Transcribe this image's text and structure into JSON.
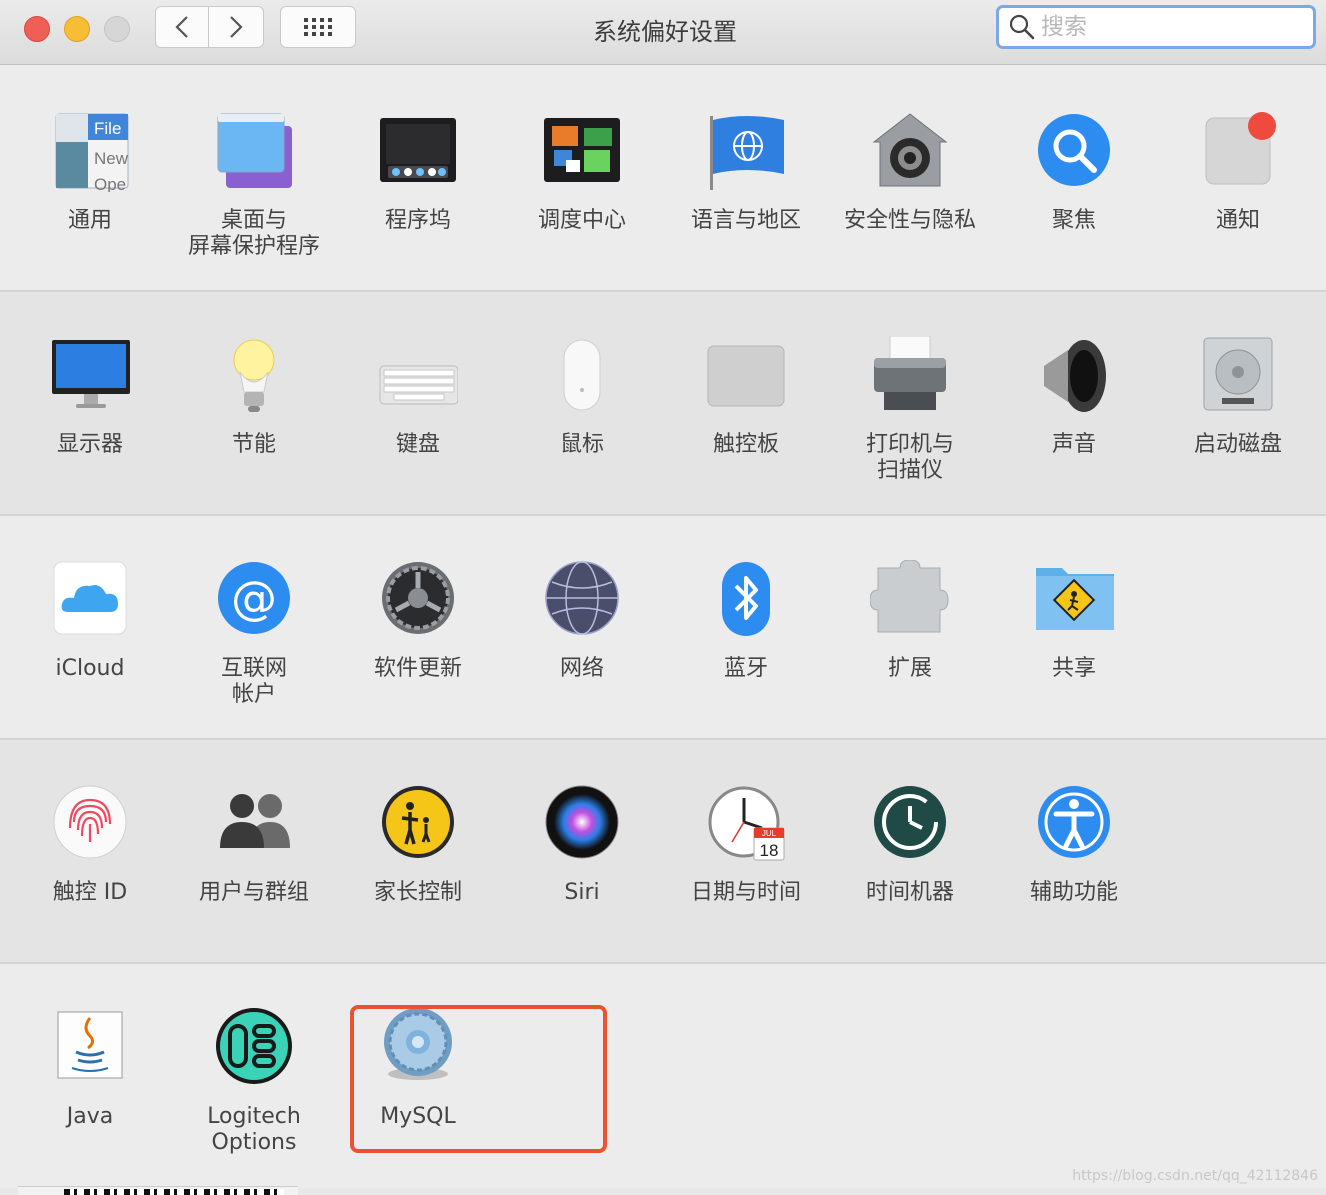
{
  "window": {
    "title": "系统偏好设置",
    "search": {
      "placeholder": "搜索",
      "value": ""
    },
    "focus_color": "#7aa8e8"
  },
  "sections": [
    {
      "panes": [
        {
          "label": "通用",
          "icon": "general-icon"
        },
        {
          "label": "桌面与\n屏幕保护程序",
          "icon": "desktop-screensaver-icon"
        },
        {
          "label": "程序坞",
          "icon": "dock-icon"
        },
        {
          "label": "调度中心",
          "icon": "mission-control-icon"
        },
        {
          "label": "语言与地区",
          "icon": "language-region-icon"
        },
        {
          "label": "安全性与隐私",
          "icon": "security-privacy-icon"
        },
        {
          "label": "聚焦",
          "icon": "spotlight-icon"
        },
        {
          "label": "通知",
          "icon": "notifications-icon"
        }
      ]
    },
    {
      "panes": [
        {
          "label": "显示器",
          "icon": "displays-icon"
        },
        {
          "label": "节能",
          "icon": "energy-saver-icon"
        },
        {
          "label": "键盘",
          "icon": "keyboard-icon"
        },
        {
          "label": "鼠标",
          "icon": "mouse-icon"
        },
        {
          "label": "触控板",
          "icon": "trackpad-icon"
        },
        {
          "label": "打印机与\n扫描仪",
          "icon": "printers-scanners-icon"
        },
        {
          "label": "声音",
          "icon": "sound-icon"
        },
        {
          "label": "启动磁盘",
          "icon": "startup-disk-icon"
        }
      ]
    },
    {
      "panes": [
        {
          "label": "iCloud",
          "icon": "icloud-icon"
        },
        {
          "label": "互联网\n帐户",
          "icon": "internet-accounts-icon"
        },
        {
          "label": "软件更新",
          "icon": "software-update-icon"
        },
        {
          "label": "网络",
          "icon": "network-icon"
        },
        {
          "label": "蓝牙",
          "icon": "bluetooth-icon"
        },
        {
          "label": "扩展",
          "icon": "extensions-icon"
        },
        {
          "label": "共享",
          "icon": "sharing-icon"
        }
      ]
    },
    {
      "panes": [
        {
          "label": "触控 ID",
          "icon": "touch-id-icon"
        },
        {
          "label": "用户与群组",
          "icon": "users-groups-icon"
        },
        {
          "label": "家长控制",
          "icon": "parental-controls-icon"
        },
        {
          "label": "Siri",
          "icon": "siri-icon"
        },
        {
          "label": "日期与时间",
          "icon": "date-time-icon"
        },
        {
          "label": "时间机器",
          "icon": "time-machine-icon"
        },
        {
          "label": "辅助功能",
          "icon": "accessibility-icon"
        }
      ]
    },
    {
      "panes": [
        {
          "label": "Java",
          "icon": "java-icon"
        },
        {
          "label": "Logitech Options",
          "icon": "logitech-options-icon"
        },
        {
          "label": "MySQL",
          "icon": "mysql-icon"
        }
      ]
    }
  ],
  "general_icon_text": {
    "file": "File",
    "new": "New",
    "open": "Ope"
  },
  "date_icon": {
    "month": "JUL",
    "day": "18"
  },
  "highlight_color": "#ea5232",
  "watermark": "https://blog.csdn.net/qq_42112846"
}
